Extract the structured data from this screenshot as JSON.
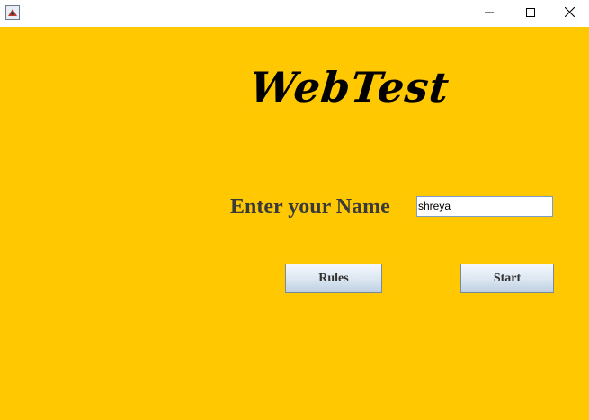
{
  "window": {
    "icons": {
      "app": "java-app-icon",
      "minimize": "minimize-icon",
      "maximize": "maximize-icon",
      "close": "close-icon"
    }
  },
  "main": {
    "logo_text": "WebTest",
    "name_label": "Enter your Name",
    "name_input_value": "shreya",
    "rules_button": "Rules",
    "start_button": "Start"
  },
  "colors": {
    "background": "#ffc800",
    "titlebar": "#ffffff",
    "label_text": "#3a3a3a"
  }
}
